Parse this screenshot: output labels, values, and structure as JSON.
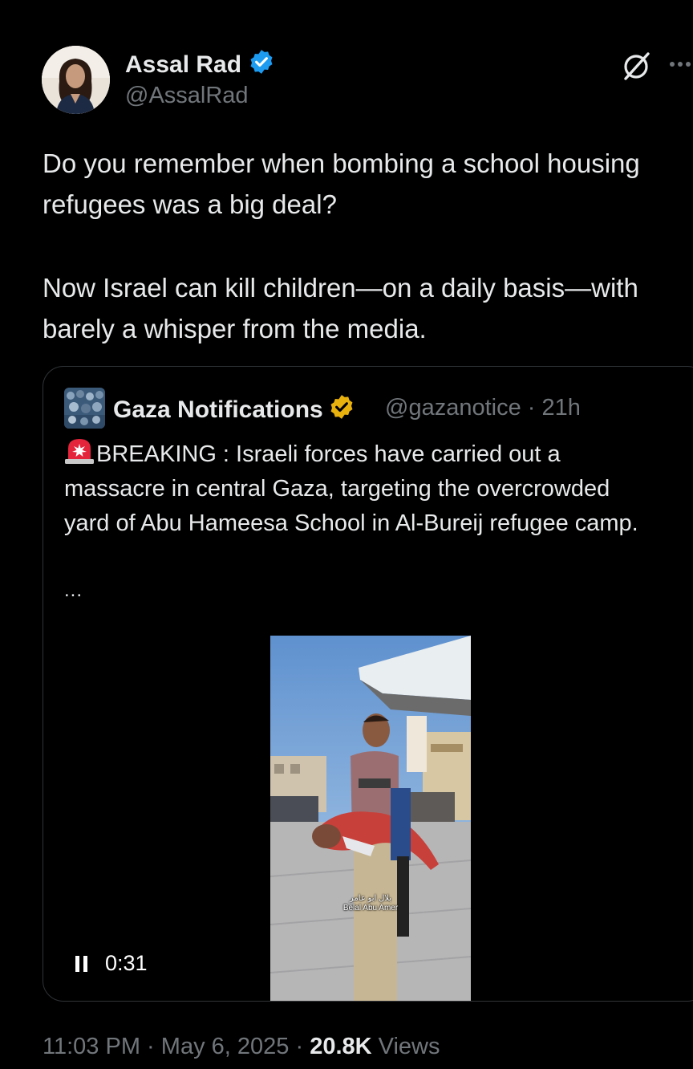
{
  "author": {
    "name": "Assal Rad",
    "handle": "@AssalRad",
    "verified_color": "#1d9bf0"
  },
  "tweet": {
    "paragraphs": [
      "Do you remember when bombing a school housing refugees was a big deal?",
      "Now Israel can kill children—on a daily basis—with barely a whisper from the media."
    ]
  },
  "quoted": {
    "name": "Gaza Notifications",
    "handle": "@gazanotice",
    "separator": "·",
    "time": "21h",
    "verified_color": "#e8b10e",
    "text": "BREAKING : Israeli forces have carried out a massacre in central Gaza, targeting the overcrowded yard of Abu Hameesa School in Al-Bureij refugee camp.",
    "ellipsis": "...",
    "video": {
      "caption_arabic": "بلال ابو عامر",
      "caption_latin": "Belal Abu Amer",
      "duration": "0:31"
    }
  },
  "footer": {
    "time": "11:03 PM",
    "sep1": "·",
    "date": "May 6, 2025",
    "sep2": "·",
    "views_count": "20.8K",
    "views_label": "Views"
  },
  "icons": {
    "grok": "grok-icon",
    "more": "more-icon",
    "pause": "pause-icon",
    "siren": "siren-icon"
  }
}
